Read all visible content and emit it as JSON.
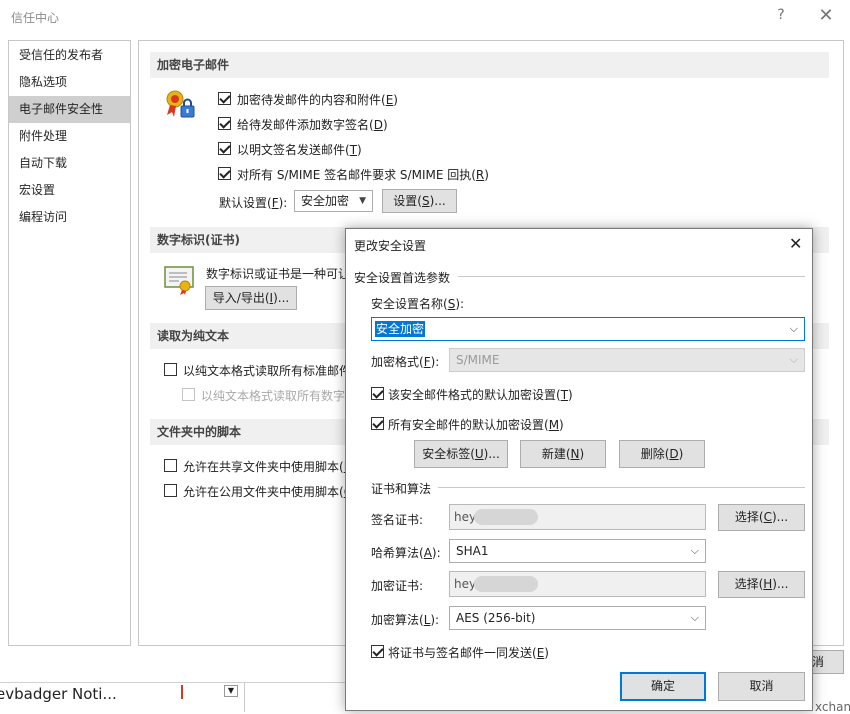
{
  "window": {
    "title": "信任中心",
    "help": "?",
    "close": "✕"
  },
  "sidebar": {
    "items": [
      {
        "label": "受信任的发布者"
      },
      {
        "label": "隐私选项"
      },
      {
        "label": "电子邮件安全性"
      },
      {
        "label": "附件处理"
      },
      {
        "label": "自动下载"
      },
      {
        "label": "宏设置"
      },
      {
        "label": "编程访问"
      }
    ],
    "selected_index": 2
  },
  "encrypted_email": {
    "header": "加密电子邮件",
    "options": [
      {
        "text": "加密待发邮件的内容和附件(",
        "key": "E",
        "tail": ")",
        "checked": true
      },
      {
        "text": "给待发邮件添加数字签名(",
        "key": "D",
        "tail": ")",
        "checked": true
      },
      {
        "text": "以明文签名发送邮件(",
        "key": "T",
        "tail": ")",
        "checked": true
      },
      {
        "text": "对所有 S/MIME 签名邮件要求 S/MIME 回执(",
        "key": "R",
        "tail": ")",
        "checked": true
      }
    ],
    "default_setting_label": "默认设置(",
    "default_setting_key": "F",
    "default_setting_tail": "):",
    "default_setting_value": "安全加密",
    "settings_button": "设置(",
    "settings_key": "S",
    "settings_tail": ")..."
  },
  "digital_id": {
    "header": "数字标识(证书)",
    "description": "数字标识或证书是一种可让你在电子交易中证明身份的文档。",
    "import_export_button": "导入/导出(",
    "import_export_key": "I",
    "import_export_tail": ")..."
  },
  "plain_text": {
    "header": "读取为纯文本",
    "option1": "以纯文本格式读取所有标准邮件",
    "option2": "以纯文本格式读取所有数字签名邮件"
  },
  "folder_scripts": {
    "header": "文件夹中的脚本",
    "option1": "允许在共享文件夹中使用脚本(",
    "option1_key": "H",
    "option1_tail": ")",
    "option2": "允许在公用文件夹中使用脚本(",
    "option2_key": "O",
    "option2_tail": ")"
  },
  "dialog": {
    "title": "更改安全设置",
    "close": "✕",
    "group1_title": "安全设置首选参数",
    "name_label": "安全设置名称(",
    "name_key": "S",
    "name_tail": "):",
    "name_value": "安全加密",
    "format_label": "加密格式(",
    "format_key": "F",
    "format_tail": "):",
    "format_value": "S/MIME",
    "default_format_check": "该安全邮件格式的默认加密设置(",
    "default_format_key": "T",
    "default_format_tail": ")",
    "default_all_check": "所有安全邮件的默认加密设置(",
    "default_all_key": "M",
    "default_all_tail": ")",
    "security_labels_btn": "安全标签(",
    "security_labels_key": "U",
    "security_labels_tail": ")...",
    "new_btn": "新建(",
    "new_key": "N",
    "new_tail": ")",
    "delete_btn": "删除(",
    "delete_key": "D",
    "delete_tail": ")",
    "group2_title": "证书和算法",
    "sign_cert_label": "签名证书:",
    "sign_cert_value": "hey",
    "choose1_btn": "选择(",
    "choose1_key": "C",
    "choose1_tail": ")...",
    "hash_label": "哈希算法(",
    "hash_key": "A",
    "hash_tail": "):",
    "hash_value": "SHA1",
    "enc_cert_label": "加密证书:",
    "enc_cert_value": "hey",
    "choose2_btn": "选择(",
    "choose2_key": "H",
    "choose2_tail": ")...",
    "enc_algo_label": "加密算法(",
    "enc_algo_key": "L",
    "enc_algo_tail": "):",
    "enc_algo_value": "AES (256-bit)",
    "send_certs_check": "将证书与签名邮件一同发送(",
    "send_certs_key": "E",
    "send_certs_tail": ")",
    "ok_btn": "确定",
    "cancel_btn": "取消"
  },
  "background": {
    "partial_text_left": "evbadger Noti...",
    "partial_text_right": "xchanc",
    "partial_button": "消"
  }
}
